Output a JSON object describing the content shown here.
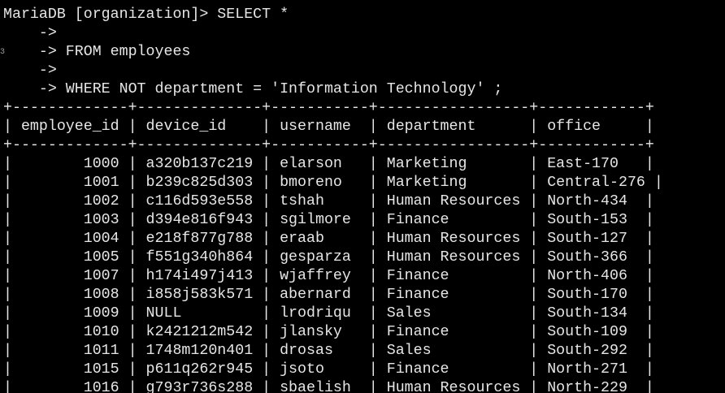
{
  "terminal": {
    "query_lines": [
      "MariaDB [organization]> SELECT *",
      "    ->",
      "    -> FROM employees",
      "    ->",
      "    -> WHERE NOT department = 'Information Technology' ;"
    ],
    "border": "+-------------+--------------+-----------+-----------------+------------+",
    "header": "| employee_id | device_id    | username  | department      | office     |",
    "rows": [
      "|        1000 | a320b137c219 | elarson   | Marketing       | East-170   |",
      "|        1001 | b239c825d303 | bmoreno   | Marketing       | Central-276 |",
      "|        1002 | c116d593e558 | tshah     | Human Resources | North-434  |",
      "|        1003 | d394e816f943 | sgilmore  | Finance         | South-153  |",
      "|        1004 | e218f877g788 | eraab     | Human Resources | South-127  |",
      "|        1005 | f551g340h864 | gesparza  | Human Resources | South-366  |",
      "|        1007 | h174i497j413 | wjaffrey  | Finance         | North-406  |",
      "|        1008 | i858j583k571 | abernard  | Finance         | South-170  |",
      "|        1009 | NULL         | lrodriqu  | Sales           | South-134  |",
      "|        1010 | k2421212m542 | jlansky   | Finance         | South-109  |",
      "|        1011 | 1748m120n401 | drosas    | Sales           | South-292  |",
      "|        1015 | p611q262r945 | jsoto     | Finance         | North-271  |",
      "|        1016 | g793r736s288 | sbaelish  | Human Resources | North-229  |"
    ]
  }
}
